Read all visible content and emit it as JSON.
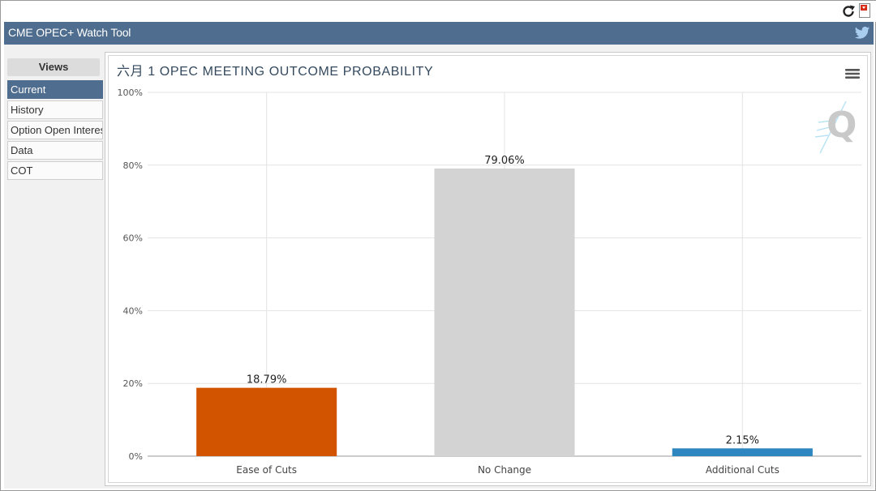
{
  "app": {
    "title": "CME OPEC+ Watch Tool"
  },
  "toolbar": {
    "icons": [
      "refresh-icon",
      "pdf-icon",
      "twitter-icon"
    ]
  },
  "sidebar": {
    "header": "Views",
    "items": [
      {
        "label": "Current",
        "active": true
      },
      {
        "label": "History",
        "active": false
      },
      {
        "label": "Option Open Interest",
        "active": false
      },
      {
        "label": "Data",
        "active": false
      },
      {
        "label": "COT",
        "active": false
      }
    ]
  },
  "colors": {
    "header_bar": "#4f6d8e",
    "ease": "#d35400",
    "no_change": "#d3d3d3",
    "additional": "#2e86c1"
  },
  "chart_data": {
    "type": "bar",
    "title": "六月 1 OPEC MEETING OUTCOME PROBABILITY",
    "categories": [
      "Ease of Cuts",
      "No Change",
      "Additional Cuts"
    ],
    "values": [
      18.79,
      79.06,
      2.15
    ],
    "data_labels": [
      "18.79%",
      "79.06%",
      "2.15%"
    ],
    "bar_colors": [
      "#d35400",
      "#d3d3d3",
      "#2e86c1"
    ],
    "ylim": [
      0,
      100
    ],
    "yticks": [
      0,
      20,
      40,
      60,
      80,
      100
    ],
    "ytick_labels": [
      "0%",
      "20%",
      "40%",
      "60%",
      "80%",
      "100%"
    ],
    "grid": true,
    "xlabel": "",
    "ylabel": ""
  }
}
